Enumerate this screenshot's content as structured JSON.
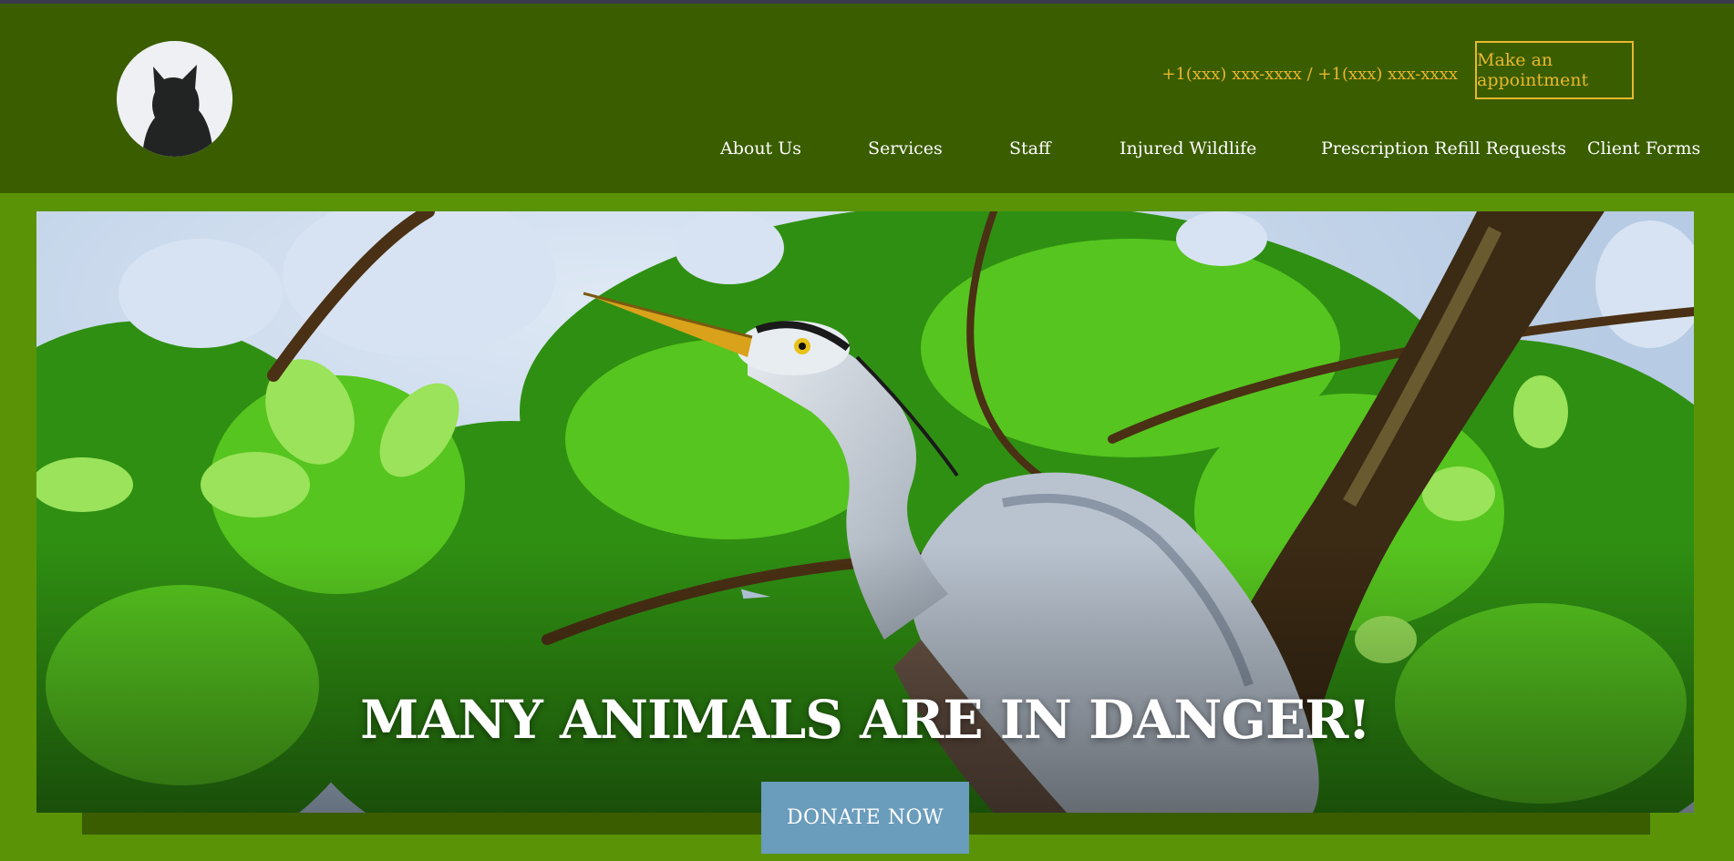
{
  "header": {
    "phone": "+1(xxx) xxx-xxxx / +1(xxx) xxx-xxxx",
    "appointment_label": "Make an appointment",
    "nav": [
      {
        "label": "About Us"
      },
      {
        "label": "Services"
      },
      {
        "label": "Staff"
      },
      {
        "label": "Injured Wildlife"
      },
      {
        "label": "Prescription Refill Requests"
      },
      {
        "label": "Client Forms"
      }
    ]
  },
  "hero": {
    "headline": "MANY ANIMALS ARE IN DANGER!",
    "donate_label": "DONATE NOW",
    "image_subject": "great-blue-heron-in-tree"
  },
  "colors": {
    "header_bg": "#3a5d00",
    "page_bg": "#5a9406",
    "accent_gold": "#e9b82c",
    "donate_bg": "#6a9cbc"
  }
}
